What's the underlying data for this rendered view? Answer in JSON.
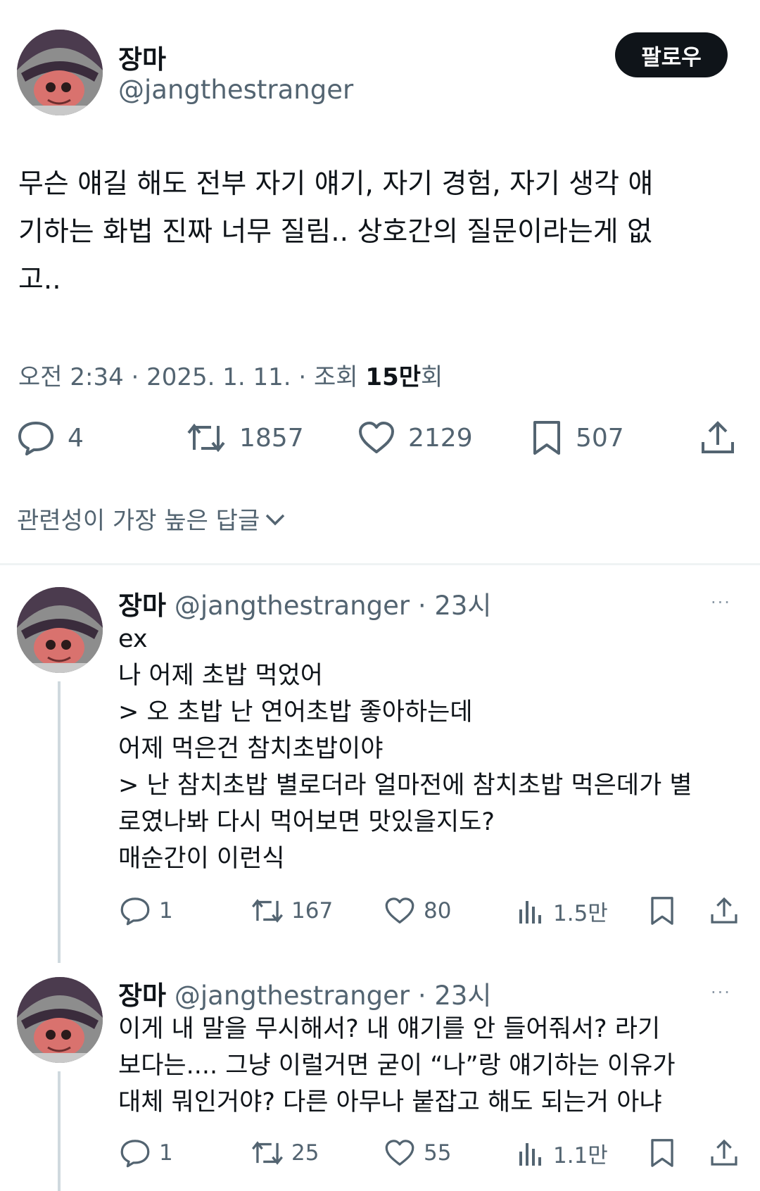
{
  "tweet": {
    "display_name": "장마",
    "handle": "@jangthestranger",
    "follow_label": "팔로우",
    "text_lines": [
      "무슨 얘길 해도 전부 자기 얘기, 자기 경험, 자기 생각 얘",
      "기하는 화법 진짜 너무 질림.. 상호간의 질문이라는게 없",
      "고.."
    ],
    "meta_prefix": "오전 2:34 · 2025. 1. 11. · 조회 ",
    "views_bold": "15만",
    "views_suffix": "회",
    "counts": {
      "replies": "4",
      "retweets": "1857",
      "likes": "2129",
      "bookmarks": "507"
    }
  },
  "sort_label": "관련성이 가장 높은 답글",
  "replies": [
    {
      "display_name": "장마",
      "handle_time": "@jangthestranger · 23시",
      "more": "···",
      "lines": [
        "ex",
        "나 어제 초밥 먹었어",
        "> 오 초밥 난 연어초밥 좋아하는데",
        "어제 먹은건 참치초밥이야",
        "> 난 참치초밥 별로더라 얼마전에 참치초밥 먹은데가 별",
        "로였나봐 다시 먹어보면 맛있을지도?",
        "매순간이 이런식"
      ],
      "counts": {
        "replies": "1",
        "retweets": "167",
        "likes": "80",
        "views": "1.5만"
      }
    },
    {
      "display_name": "장마",
      "handle_time": "@jangthestranger · 23시",
      "more": "···",
      "lines": [
        "이게 내 말을 무시해서? 내 얘기를 안 들어줘서? 라기",
        "보다는.... 그냥 이럴거면 굳이 “나”랑 얘기하는 이유가",
        "대체 뭐인거야? 다른 아무나 붙잡고 해도 되는거 아냐"
      ],
      "counts": {
        "replies": "1",
        "retweets": "25",
        "likes": "55",
        "views": "1.1만"
      }
    }
  ]
}
